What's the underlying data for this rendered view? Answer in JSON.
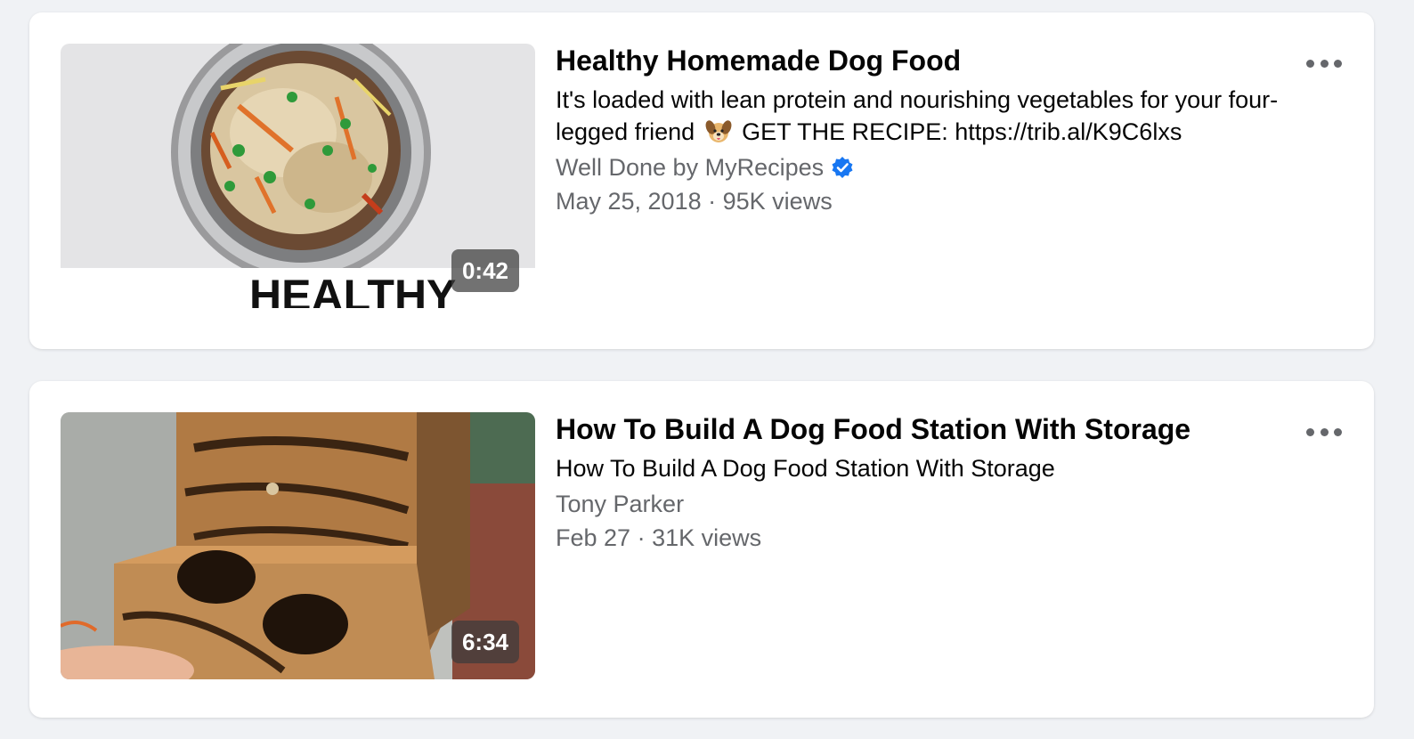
{
  "videos": [
    {
      "title": "Healthy Homemade Dog Food",
      "description_before_emoji": "It's loaded with lean protein and nourishing vegetables for your four-legged friend",
      "emoji": "dog-face-emoji",
      "description_after_emoji": "GET THE RECIPE: https://trib.al/K9C6lxs",
      "channel": "Well Done by MyRecipes",
      "verified": true,
      "date": "May 25, 2018",
      "separator": "·",
      "views": "95K views",
      "duration": "0:42",
      "thumbnail_caption": "HEALTHY"
    },
    {
      "title": "How To Build A Dog Food Station With Storage",
      "description": "How To Build A Dog Food Station With Storage",
      "channel": "Tony Parker",
      "verified": false,
      "date": "Feb 27",
      "separator": "·",
      "views": "31K views",
      "duration": "6:34"
    }
  ],
  "icons": {
    "more": "more-options-icon",
    "verified": "verified-badge-icon"
  },
  "colors": {
    "background": "#f0f2f5",
    "card": "#ffffff",
    "title": "#050505",
    "secondary": "#65676b",
    "verified_blue": "#1877f2"
  }
}
